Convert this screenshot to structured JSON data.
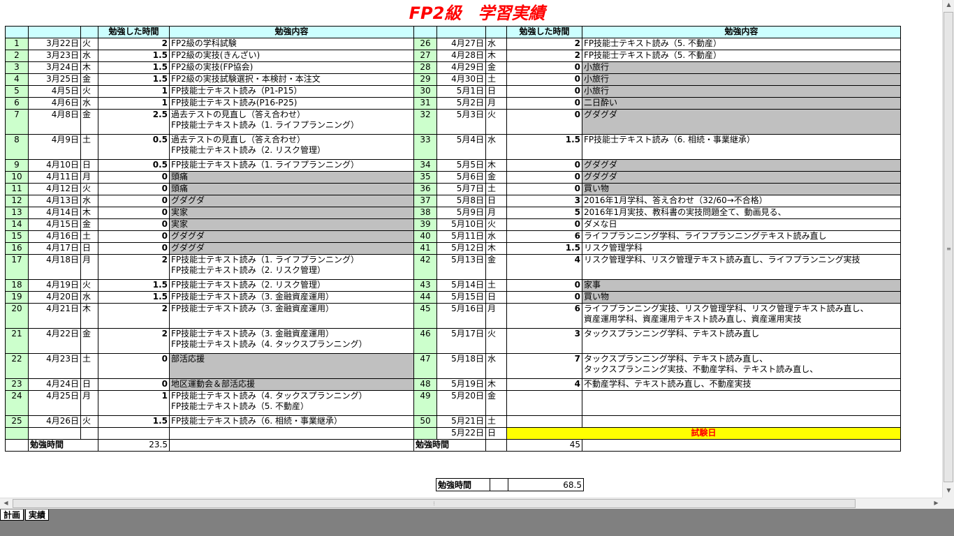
{
  "title": "FP2級　学習実績",
  "headers": {
    "hours": "勉強した時間",
    "content": "勉強内容"
  },
  "left_rows": [
    {
      "num": "1",
      "date": "3月22日",
      "day": "火",
      "hours": "2",
      "content": [
        "FP2級の学科試験"
      ],
      "gray": false
    },
    {
      "num": "2",
      "date": "3月23日",
      "day": "水",
      "hours": "1.5",
      "content": [
        "FP2級の実技(きんざい)"
      ],
      "gray": false
    },
    {
      "num": "3",
      "date": "3月24日",
      "day": "木",
      "hours": "1.5",
      "content": [
        "FP2級の実技(FP協会)"
      ],
      "gray": false
    },
    {
      "num": "4",
      "date": "3月25日",
      "day": "金",
      "hours": "1.5",
      "content": [
        "FP2級の実技試験選択・本検討・本注文"
      ],
      "gray": false
    },
    {
      "num": "5",
      "date": "4月5日",
      "day": "火",
      "hours": "1",
      "content": [
        "FP技能士テキスト読み（P1-P15）"
      ],
      "gray": false
    },
    {
      "num": "6",
      "date": "4月6日",
      "day": "水",
      "hours": "1",
      "content": [
        "FP技能士テキスト読み(P16-P25)"
      ],
      "gray": false
    },
    {
      "num": "7",
      "date": "4月8日",
      "day": "金",
      "hours": "2.5",
      "content": [
        "過去テストの見直し（答え合わせ）",
        "FP技能士テキスト読み（1. ライフプランニング）"
      ],
      "gray": false
    },
    {
      "num": "8",
      "date": "4月9日",
      "day": "土",
      "hours": "0.5",
      "content": [
        "過去テストの見直し（答え合わせ）",
        "FP技能士テキスト読み（2. リスク管理）"
      ],
      "gray": false
    },
    {
      "num": "9",
      "date": "4月10日",
      "day": "日",
      "hours": "0.5",
      "content": [
        "FP技能士テキスト読み（1. ライフプランニング）"
      ],
      "gray": false
    },
    {
      "num": "10",
      "date": "4月11日",
      "day": "月",
      "hours": "0",
      "content": [
        "頭痛"
      ],
      "gray": true
    },
    {
      "num": "11",
      "date": "4月12日",
      "day": "火",
      "hours": "0",
      "content": [
        "頭痛"
      ],
      "gray": true
    },
    {
      "num": "12",
      "date": "4月13日",
      "day": "水",
      "hours": "0",
      "content": [
        "グダグダ"
      ],
      "gray": true
    },
    {
      "num": "13",
      "date": "4月14日",
      "day": "木",
      "hours": "0",
      "content": [
        "実家"
      ],
      "gray": true
    },
    {
      "num": "14",
      "date": "4月15日",
      "day": "金",
      "hours": "0",
      "content": [
        "実家"
      ],
      "gray": true
    },
    {
      "num": "15",
      "date": "4月16日",
      "day": "土",
      "hours": "0",
      "content": [
        "グダグダ"
      ],
      "gray": true
    },
    {
      "num": "16",
      "date": "4月17日",
      "day": "日",
      "hours": "0",
      "content": [
        "グダグダ"
      ],
      "gray": true
    },
    {
      "num": "17",
      "date": "4月18日",
      "day": "月",
      "hours": "2",
      "content": [
        "FP技能士テキスト読み（1. ライフプランニング）",
        "FP技能士テキスト読み（2. リスク管理）"
      ],
      "gray": false
    },
    {
      "num": "18",
      "date": "4月19日",
      "day": "火",
      "hours": "1.5",
      "content": [
        "FP技能士テキスト読み（2. リスク管理）"
      ],
      "gray": false
    },
    {
      "num": "19",
      "date": "4月20日",
      "day": "水",
      "hours": "1.5",
      "content": [
        "FP技能士テキスト読み（3. 金融資産運用）"
      ],
      "gray": false
    },
    {
      "num": "20",
      "date": "4月21日",
      "day": "木",
      "hours": "2",
      "content": [
        "FP技能士テキスト読み（3. 金融資産運用）"
      ],
      "gray": false
    },
    {
      "num": "21",
      "date": "4月22日",
      "day": "金",
      "hours": "2",
      "content": [
        "FP技能士テキスト読み（3. 金融資産運用）",
        "FP技能士テキスト読み（4. タックスプランニング）"
      ],
      "gray": false
    },
    {
      "num": "22",
      "date": "4月23日",
      "day": "土",
      "hours": "0",
      "content": [
        "部活応援"
      ],
      "gray": true
    },
    {
      "num": "23",
      "date": "4月24日",
      "day": "日",
      "hours": "0",
      "content": [
        "地区運動会＆部活応援"
      ],
      "gray": true
    },
    {
      "num": "24",
      "date": "4月25日",
      "day": "月",
      "hours": "1",
      "content": [
        "FP技能士テキスト読み（4. タックスプランニング）",
        "FP技能士テキスト読み（5. 不動産）"
      ],
      "gray": false
    },
    {
      "num": "25",
      "date": "4月26日",
      "day": "火",
      "hours": "1.5",
      "content": [
        "FP技能士テキスト読み（6. 相続・事業継承）"
      ],
      "gray": false
    }
  ],
  "right_rows": [
    {
      "num": "26",
      "date": "4月27日",
      "day": "水",
      "hours": "2",
      "content": [
        "FP技能士テキスト読み（5. 不動産）"
      ],
      "gray": false
    },
    {
      "num": "27",
      "date": "4月28日",
      "day": "木",
      "hours": "2",
      "content": [
        "FP技能士テキスト読み（5. 不動産）"
      ],
      "gray": false
    },
    {
      "num": "28",
      "date": "4月29日",
      "day": "金",
      "hours": "0",
      "content": [
        "小旅行"
      ],
      "gray": true
    },
    {
      "num": "29",
      "date": "4月30日",
      "day": "土",
      "hours": "0",
      "content": [
        "小旅行"
      ],
      "gray": true
    },
    {
      "num": "30",
      "date": "5月1日",
      "day": "日",
      "hours": "0",
      "content": [
        "小旅行"
      ],
      "gray": true
    },
    {
      "num": "31",
      "date": "5月2日",
      "day": "月",
      "hours": "0",
      "content": [
        "二日酔い"
      ],
      "gray": true
    },
    {
      "num": "32",
      "date": "5月3日",
      "day": "火",
      "hours": "0",
      "content": [
        "グダグダ"
      ],
      "gray": true
    },
    {
      "num": "33",
      "date": "5月4日",
      "day": "水",
      "hours": "1.5",
      "content": [
        "FP技能士テキスト読み（6. 相続・事業継承）"
      ],
      "gray": false
    },
    {
      "num": "34",
      "date": "5月5日",
      "day": "木",
      "hours": "0",
      "content": [
        "グダグダ"
      ],
      "gray": true
    },
    {
      "num": "35",
      "date": "5月6日",
      "day": "金",
      "hours": "0",
      "content": [
        "グダグダ"
      ],
      "gray": true
    },
    {
      "num": "36",
      "date": "5月7日",
      "day": "土",
      "hours": "0",
      "content": [
        "買い物"
      ],
      "gray": true
    },
    {
      "num": "37",
      "date": "5月8日",
      "day": "日",
      "hours": "3",
      "content": [
        "2016年1月学科、答え合わせ（32/60→不合格）"
      ],
      "gray": false
    },
    {
      "num": "38",
      "date": "5月9日",
      "day": "月",
      "hours": "5",
      "content": [
        "2016年1月実技、教科書の実技問題全て、動画見る、"
      ],
      "gray": false
    },
    {
      "num": "39",
      "date": "5月10日",
      "day": "火",
      "hours": "0",
      "content": [
        "ダメな日"
      ],
      "gray": false
    },
    {
      "num": "40",
      "date": "5月11日",
      "day": "水",
      "hours": "6",
      "content": [
        "ライフプランニング学科、ライフプランニングテキスト読み直し"
      ],
      "gray": false
    },
    {
      "num": "41",
      "date": "5月12日",
      "day": "木",
      "hours": "1.5",
      "content": [
        "リスク管理学科"
      ],
      "gray": false
    },
    {
      "num": "42",
      "date": "5月13日",
      "day": "金",
      "hours": "4",
      "content": [
        "リスク管理学科、リスク管理テキスト読み直し、ライフプランニング実技"
      ],
      "gray": false
    },
    {
      "num": "43",
      "date": "5月14日",
      "day": "土",
      "hours": "0",
      "content": [
        "家事"
      ],
      "gray": true
    },
    {
      "num": "44",
      "date": "5月15日",
      "day": "日",
      "hours": "0",
      "content": [
        "買い物"
      ],
      "gray": true
    },
    {
      "num": "45",
      "date": "5月16日",
      "day": "月",
      "hours": "6",
      "content": [
        "ライフプランニング実技、リスク管理学科、リスク管理テキスト読み直し、",
        "資産運用学科、資産運用テキスト読み直し、資産運用実技"
      ],
      "gray": false
    },
    {
      "num": "46",
      "date": "5月17日",
      "day": "火",
      "hours": "3",
      "content": [
        "タックスプランニング学科、テキスト読み直し"
      ],
      "gray": false
    },
    {
      "num": "47",
      "date": "5月18日",
      "day": "水",
      "hours": "7",
      "content": [
        "タックスプランニング学科、テキスト読み直し、",
        "タックスプランニング実技、不動産学科、テキスト読み直し、"
      ],
      "gray": false
    },
    {
      "num": "48",
      "date": "5月19日",
      "day": "木",
      "hours": "4",
      "content": [
        "不動産学科、テキスト読み直し、不動産実技"
      ],
      "gray": false
    },
    {
      "num": "49",
      "date": "5月20日",
      "day": "金",
      "hours": "",
      "content": [
        ""
      ],
      "gray": false
    },
    {
      "num": "50",
      "date": "5月21日",
      "day": "土",
      "hours": "",
      "content": [
        ""
      ],
      "gray": false
    }
  ],
  "exam_row": {
    "date": "5月22日",
    "day": "日",
    "label": "試験日"
  },
  "subtotal": {
    "label": "勉強時間",
    "left": "23.5",
    "right": "45"
  },
  "grand_total": {
    "label": "勉強時間",
    "value": "68.5"
  },
  "sheet_tabs": [
    "計画",
    "実績"
  ],
  "colors": {
    "title": "#ff0000",
    "header_bg": "#ccffff",
    "num_bg": "#ccffcc",
    "gray": "#c0c0c0",
    "exam_bg": "#ffff00"
  }
}
